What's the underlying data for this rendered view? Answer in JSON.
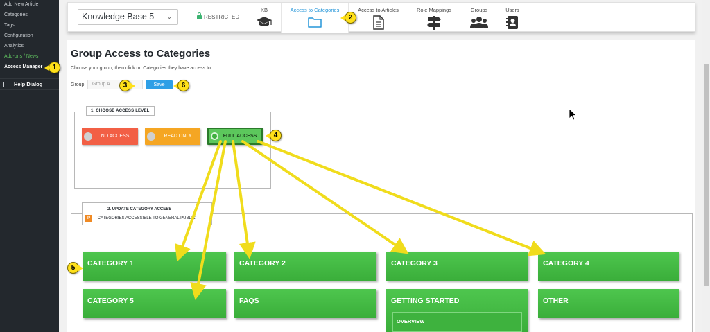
{
  "sidebar": {
    "items": [
      {
        "label": "Add New Article"
      },
      {
        "label": "Categories"
      },
      {
        "label": "Tags"
      },
      {
        "label": "Configuration"
      },
      {
        "label": "Analytics"
      },
      {
        "label": "Add-ons / News"
      },
      {
        "label": "Access Manager"
      }
    ],
    "help_label": "Help Dialog"
  },
  "topnav": {
    "kb_selected": "Knowledge Base 5",
    "restricted_label": "RESTRICTED",
    "tabs": [
      {
        "label": "KB",
        "icon": "graduation-cap-icon"
      },
      {
        "label": "Access to Categories",
        "icon": "folder-icon"
      },
      {
        "label": "Access to Articles",
        "icon": "document-icon"
      },
      {
        "label": "Role Mappings",
        "icon": "signpost-icon"
      },
      {
        "label": "Groups",
        "icon": "users-icon"
      },
      {
        "label": "Users",
        "icon": "contact-book-icon"
      }
    ]
  },
  "main": {
    "title": "Group Access to Categories",
    "instructions": "Choose your group, then click on Categories they have access to.",
    "group_label": "Group:",
    "group_value": "Group A",
    "save_label": "Save",
    "access_section": {
      "legend": "1. CHOOSE ACCESS LEVEL",
      "buttons": [
        {
          "label": "NO ACCESS",
          "color": "#f25f45"
        },
        {
          "label": "READ ONLY",
          "color": "#f5a623"
        },
        {
          "label": "FULL ACCESS",
          "color": "#5cc75c",
          "selected": true
        }
      ]
    },
    "category_section": {
      "legend": "2. UPDATE CATEGORY ACCESS",
      "public_badge": "P",
      "public_note": "- CATEGORIES ACCESSIBLE TO GENERAL PUBLIC",
      "categories": [
        {
          "label": "CATEGORY 1"
        },
        {
          "label": "CATEGORY 2"
        },
        {
          "label": "CATEGORY 3"
        },
        {
          "label": "CATEGORY 4"
        },
        {
          "label": "CATEGORY 5"
        },
        {
          "label": "FAQS"
        },
        {
          "label": "GETTING STARTED"
        },
        {
          "label": "OTHER"
        }
      ],
      "subcategories": [
        {
          "label": "OVERVIEW"
        }
      ]
    }
  },
  "annotations": {
    "markers": [
      "1",
      "2",
      "3",
      "4",
      "5",
      "6"
    ],
    "color": "#ffe01a"
  },
  "colors": {
    "accent": "#2596d9",
    "category_green": "#3eb23e",
    "sidebar_bg": "#23282d"
  }
}
